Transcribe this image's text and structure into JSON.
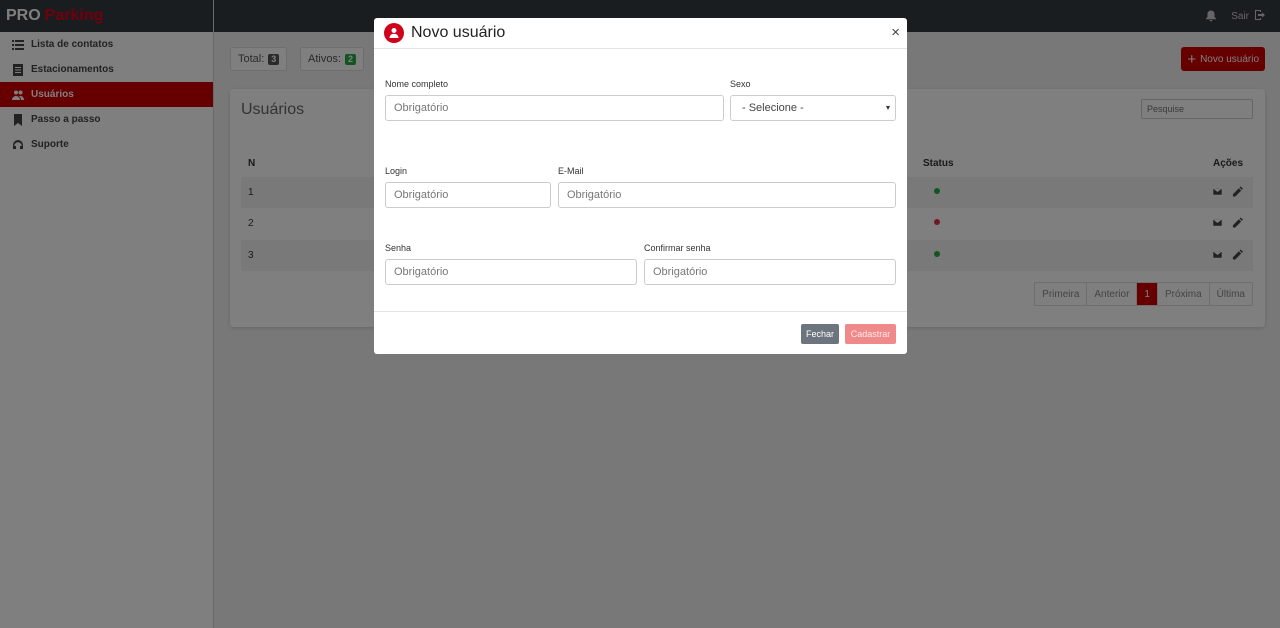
{
  "brand": {
    "part1": "PRO",
    "part2": "Parking"
  },
  "sidebar": {
    "items": [
      {
        "label": "Lista de contatos",
        "icon": "list-icon"
      },
      {
        "label": "Estacionamentos",
        "icon": "document-icon"
      },
      {
        "label": "Usuários",
        "icon": "users-icon",
        "active": true
      },
      {
        "label": "Passo a passo",
        "icon": "bookmark-icon"
      },
      {
        "label": "Suporte",
        "icon": "headset-icon"
      }
    ]
  },
  "topbar": {
    "logout_label": "Sair"
  },
  "stats": {
    "total_label": "Total:",
    "total_value": "3",
    "active_label": "Ativos:",
    "active_value": "2"
  },
  "new_user_button": "Novo usuário",
  "users_card": {
    "title": "Usuários",
    "search_placeholder": "Pesquise",
    "columns": {
      "n": "N",
      "status": "Status",
      "actions": "Ações"
    },
    "rows": [
      {
        "n": "1",
        "status_color": "#28a745"
      },
      {
        "n": "2",
        "status_color": "#dc3545"
      },
      {
        "n": "3",
        "status_color": "#28a745"
      }
    ],
    "pagination": {
      "first": "Primeira",
      "prev": "Anterior",
      "current": "1",
      "next": "Próxima",
      "last": "Última"
    }
  },
  "modal": {
    "title": "Novo usuário",
    "close": "×",
    "fields": {
      "full_name": {
        "label": "Nome completo",
        "placeholder": "Obrigatório"
      },
      "sex": {
        "label": "Sexo",
        "value": "- Selecione -"
      },
      "login": {
        "label": "Login",
        "placeholder": "Obrigatório"
      },
      "email": {
        "label": "E-Mail",
        "placeholder": "Obrigatório"
      },
      "password": {
        "label": "Senha",
        "placeholder": "Obrigatório"
      },
      "confirm_password": {
        "label": "Confirmar senha",
        "placeholder": "Obrigatório"
      }
    },
    "buttons": {
      "close": "Fechar",
      "submit": "Cadastrar"
    }
  },
  "colors": {
    "brand_red": "#cc0000",
    "topbar": "#343a40",
    "submit_disabled": "#f08a8a",
    "close_button": "#6c757d"
  }
}
